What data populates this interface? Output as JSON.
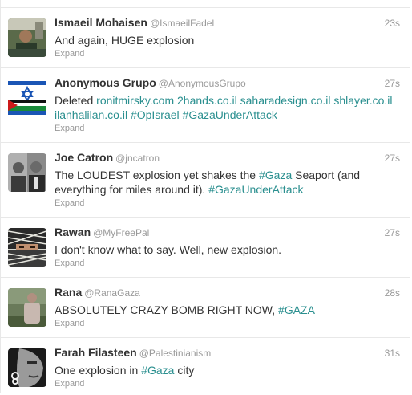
{
  "tweets": [
    {
      "fullname": "Ismaeil Mohaisen",
      "username": "@IsmaeilFadel",
      "time": "23s",
      "text": "And again, HUGE explosion",
      "expand": "Expand",
      "avatar": "man-in-office-photo"
    },
    {
      "fullname": "Anonymous Grupo",
      "username": "@AnonymousGrupo",
      "time": "27s",
      "text_prefix": "Deleted ",
      "links": [
        "ronitmirsky.com",
        "2hands.co.il",
        "saharadesign.co.il",
        "shlayer.co.il",
        "ilanhalilan.co.il",
        "#OpIsrael",
        "#GazaUnderAttack"
      ],
      "expand": "Expand",
      "avatar": "palestine-israel-flags"
    },
    {
      "fullname": "Joe Catron",
      "username": "@jncatron",
      "time": "27s",
      "text_1": "The LOUDEST explosion yet shakes the ",
      "hashtag_1": "#Gaza",
      "text_2": " Seaport (and everything for miles around it). ",
      "hashtag_2": "#GazaUnderAttack",
      "expand": "Expand",
      "avatar": "two-men-grayscale-photo"
    },
    {
      "fullname": "Rawan",
      "username": "@MyFreePal",
      "time": "27s",
      "text": "I don't know what to say. Well, new explosion.",
      "expand": "Expand",
      "avatar": "keffiyeh-face-photo"
    },
    {
      "fullname": "Rana",
      "username": "@RanaGaza",
      "time": "28s",
      "text_1": "ABSOLUTELY CRAZY BOMB RIGHT NOW, ",
      "hashtag_1": "#GAZA",
      "expand": "Expand",
      "avatar": "person-outdoors-photo"
    },
    {
      "fullname": "Farah Filasteen",
      "username": "@Palestinianism",
      "time": "31s",
      "text_1": "One explosion in ",
      "hashtag_1": "#Gaza",
      "text_2": " city",
      "expand": "Expand",
      "avatar": "woman-face-grayscale-photo"
    }
  ],
  "colors": {
    "link": "#2a8f8f",
    "name": "#333333",
    "meta": "#999999",
    "divider": "#e8e8e8"
  }
}
